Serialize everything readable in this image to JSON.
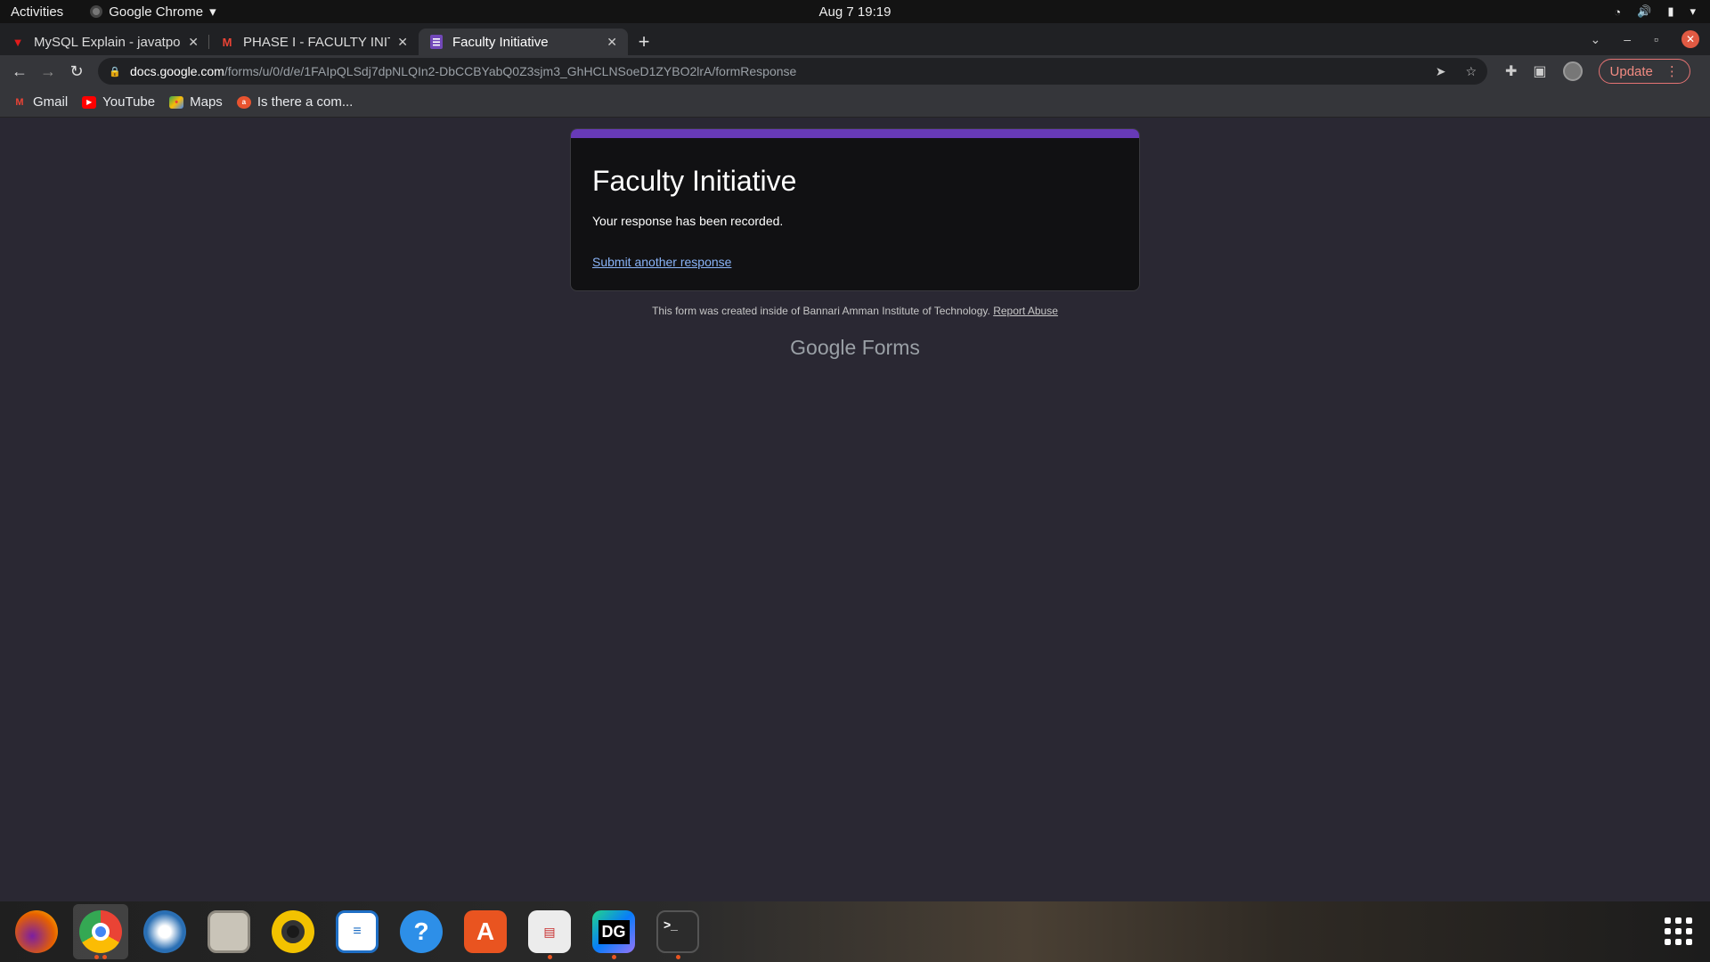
{
  "topbar": {
    "activities": "Activities",
    "app_name": "Google Chrome",
    "clock": "Aug 7  19:19"
  },
  "tabs": [
    {
      "title": "MySQL Explain - javatpoint",
      "icon": "javatpoint-favicon",
      "active": false
    },
    {
      "title": "PHASE I - FACULTY INITIATIVE",
      "icon": "gmail-favicon",
      "active": false
    },
    {
      "title": "Faculty Initiative",
      "icon": "google-forms-favicon",
      "active": true
    }
  ],
  "toolbar": {
    "url_host": "docs.google.com",
    "url_path": "/forms/u/0/d/e/1FAIpQLSdj7dpNLQIn2-DbCCBYabQ0Z3sjm3_GhHCLNSoeD1ZYBO2lrA/formResponse",
    "update_label": "Update"
  },
  "bookmarks": [
    {
      "label": "Gmail",
      "icon": "gmail-icon"
    },
    {
      "label": "YouTube",
      "icon": "youtube-icon"
    },
    {
      "label": "Maps",
      "icon": "maps-icon"
    },
    {
      "label": "Is there a com...",
      "icon": "ask-icon"
    }
  ],
  "form": {
    "title": "Faculty Initiative",
    "message": "Your response has been recorded.",
    "submit_another": "Submit another response",
    "footer_text": "This form was created inside of Bannari Amman Institute of Technology.",
    "report_abuse": "Report Abuse",
    "brand": "Google Forms",
    "accent_color": "#673ab7"
  },
  "dock": [
    {
      "name": "firefox",
      "color": "#e66000",
      "running": false
    },
    {
      "name": "chrome",
      "color": "#4285f4",
      "running": true
    },
    {
      "name": "thunderbird",
      "color": "#2a6fb4",
      "running": false
    },
    {
      "name": "files",
      "color": "#c9c4b8",
      "running": false
    },
    {
      "name": "rhythmbox",
      "color": "#f2c200",
      "running": false
    },
    {
      "name": "writer",
      "color": "#1f6fc5",
      "running": false
    },
    {
      "name": "help",
      "color": "#2d8fe8",
      "running": false
    },
    {
      "name": "software",
      "color": "#e95420",
      "running": false
    },
    {
      "name": "document-viewer",
      "color": "#d8d8d8",
      "running": true
    },
    {
      "name": "datagrip",
      "color": "#21d789",
      "running": true
    },
    {
      "name": "terminal",
      "color": "#2c2c2c",
      "running": true
    }
  ]
}
